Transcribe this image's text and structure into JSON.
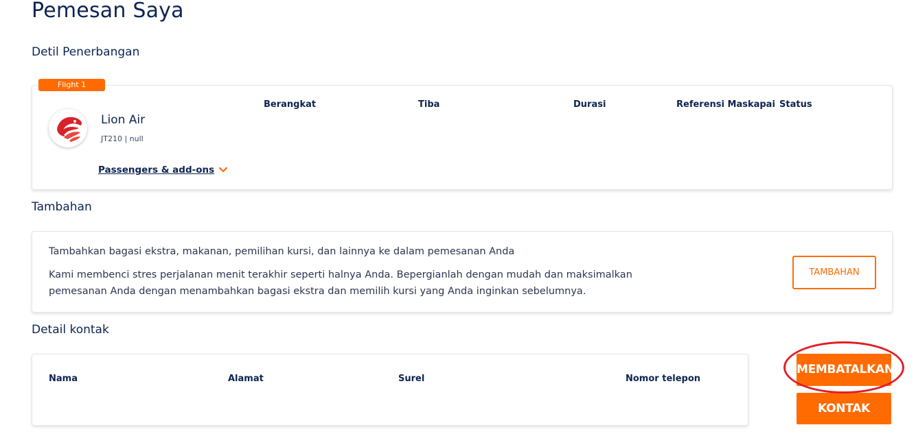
{
  "page": {
    "title": "Pemesan Saya"
  },
  "flight_section": {
    "title": "Detil Penerbangan",
    "badge": "Flight 1",
    "airline": "Lion Air",
    "code": "JT210 | null",
    "columns": [
      "Berangkat",
      "Tiba",
      "Durasi",
      "Referensi Maskapai",
      "Status"
    ],
    "passengers_link": "Passengers & add-ons"
  },
  "addons_section": {
    "title": "Tambahan",
    "line1": "Tambahkan bagasi ekstra, makanan, pemilihan kursi, dan lainnya ke dalam pemesanan Anda",
    "line2": "Kami membenci stres perjalanan menit terakhir seperti halnya Anda. Bepergianlah dengan mudah dan maksimalkan",
    "line3": "pemesanan Anda dengan menambahkan bagasi ekstra dan memilih kursi yang Anda inginkan sebelumnya.",
    "button": "TAMBAHAN"
  },
  "contact_section": {
    "title": "Detail kontak",
    "columns": [
      "Nama",
      "Alamat",
      "Surel",
      "Nomor telepon"
    ]
  },
  "actions": {
    "cancel": "MEMBATALKAN",
    "contact": "KONTAK"
  },
  "colors": {
    "accent": "#ff6b00",
    "navy": "#0d2451",
    "highlight": "#e21e26"
  },
  "icons": {
    "airline_logo": "lion-air-logo-icon",
    "expand": "chevron-down-icon"
  }
}
